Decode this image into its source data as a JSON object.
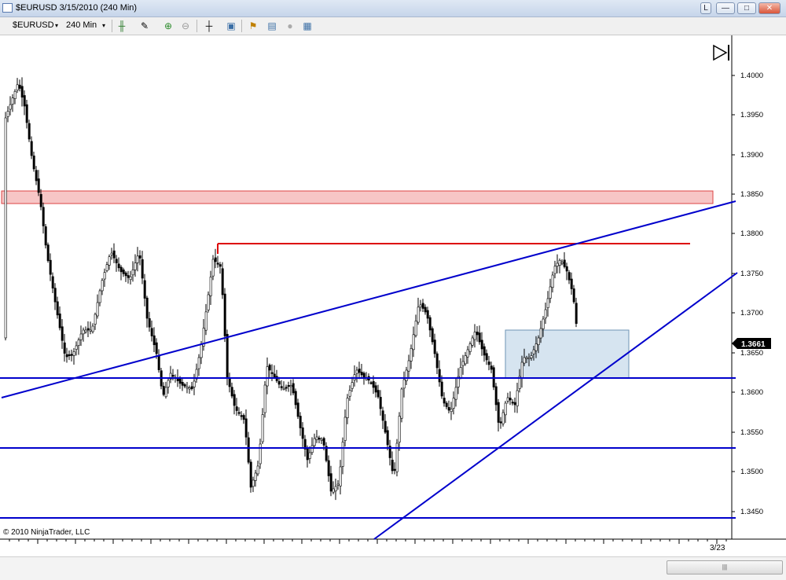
{
  "window": {
    "title": "$EURUSD  3/15/2010 (240 Min)",
    "buttons": {
      "link": "L",
      "minimize": "—",
      "maximize": "□",
      "close": "✕"
    }
  },
  "toolbar": {
    "instrument": "$EURUSD",
    "period": "240 Min",
    "dropdown_glyph": "▾",
    "icons": [
      "candlestick-style-icon",
      "pencil-draw-icon",
      "zoom-in-icon",
      "zoom-out-icon",
      "crosshair-icon",
      "data-box-icon",
      "indicators-icon",
      "strategies-icon",
      "properties-icon",
      "chart-trader-icon"
    ]
  },
  "chart": {
    "price_axis": {
      "ticks": [
        "1.4000",
        "1.3950",
        "1.3900",
        "1.3850",
        "1.3800",
        "1.3750",
        "1.3700",
        "1.3650",
        "1.3600",
        "1.3550",
        "1.3500",
        "1.3450"
      ],
      "current_price": "1.3661",
      "current_price_bg": "#000000"
    },
    "time_axis": {
      "label": "3/23"
    },
    "copyright": "© 2010 NinjaTrader, LLC",
    "colors": {
      "horizontal_lines": "#0000cc",
      "trend_lines": "#0000cc",
      "resistance_line": "#dd0000",
      "supply_zone_fill": "#f7c6c6",
      "supply_zone_border": "#dd4444",
      "demand_box_fill": "#d6e4f0",
      "demand_box_border": "#6f94b5"
    },
    "drawings": {
      "supply_zone": {
        "low": 1.384,
        "high": 1.3855
      },
      "demand_box": {
        "low": 1.3618,
        "high": 1.3677
      },
      "resistance_level": 1.3788,
      "support_levels": [
        1.3618,
        1.353,
        1.3441
      ]
    }
  },
  "scrollbar": {
    "thumb_glyph": "|||"
  }
}
